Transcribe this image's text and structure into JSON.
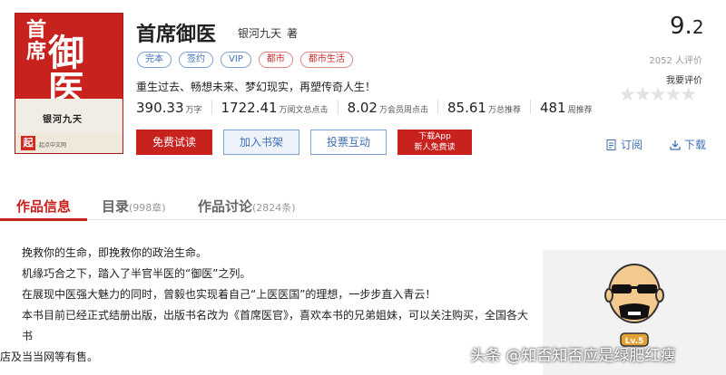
{
  "book": {
    "title": "首席御医",
    "author": "银河九天",
    "author_role": "著",
    "tags": [
      {
        "label": "完本",
        "color": "blue"
      },
      {
        "label": "签约",
        "color": "blue"
      },
      {
        "label": "VIP",
        "color": "blue"
      },
      {
        "label": "都市",
        "color": "red"
      },
      {
        "label": "都市生活",
        "color": "red"
      }
    ],
    "tagline": "重生过去、畅想未来、梦幻现实，再塑传奇人生！",
    "stats": [
      {
        "value": "390.33",
        "unit": "万字"
      },
      {
        "value": "1722.41",
        "unit": "万阅文总点击"
      },
      {
        "value": "8.02",
        "unit": "万会员周点击"
      },
      {
        "value": "85.61",
        "unit": "万总推荐"
      },
      {
        "value": "481",
        "unit": "周推荐"
      }
    ]
  },
  "cover": {
    "title_small": "首席",
    "title_large": "御医",
    "author": "银河九天",
    "logo": "起",
    "site": "起点中文网"
  },
  "buttons": {
    "read": "免费试读",
    "shelf": "加入书架",
    "vote": "投票互动",
    "app_line1": "下载App",
    "app_line2": "新人免费读"
  },
  "rating": {
    "score_int": "9.",
    "score_dec": "2",
    "raters": "2052 人评价",
    "my_rate": "我要评价",
    "stars": "★★★★★"
  },
  "actions": {
    "subscribe": "订阅",
    "download": "下载"
  },
  "tabs": [
    {
      "label": "作品信息",
      "count": ""
    },
    {
      "label": "目录",
      "count": "(998章)"
    },
    {
      "label": "作品讨论",
      "count": "(2824条)"
    }
  ],
  "intro": [
    "挽救你的生命，即挽救你的政治生命。",
    "机缘巧合之下，踏入了半官半医的“御医”之列。",
    "在展现中医强大魅力的同时，曾毅也实现着自己“上医医国”的理想，一步步直入青云！",
    "本书目前已经正式结册出版，出版书名改为《首席医官》，喜欢本书的兄弟姐妹，可以关注购买，全国各大书",
    "店及当当网等有售。"
  ],
  "sidebar": {
    "level": "Lv.5"
  },
  "watermark": "头条 @知否知否应是绿肥红瘦"
}
